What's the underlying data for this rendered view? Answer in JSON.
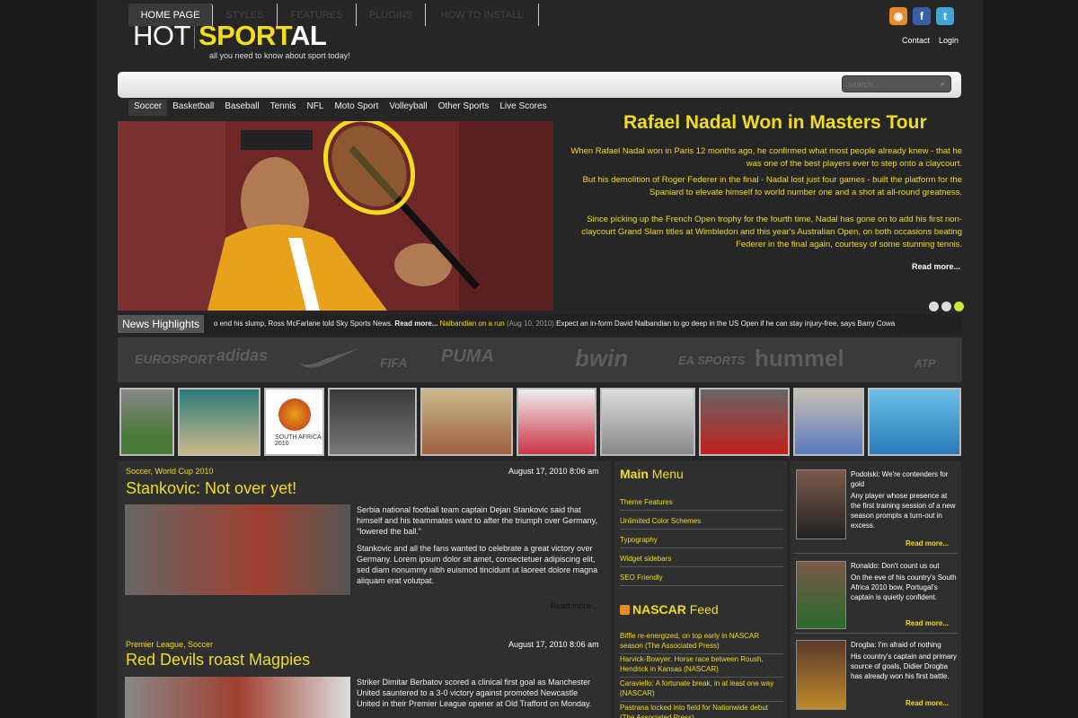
{
  "header": {
    "logo_part1": "HOT",
    "logo_part2": "SPORT",
    "logo_part3": "AL",
    "tagline": "all you need to know about sport today!",
    "links": [
      "Contact",
      "Login"
    ]
  },
  "nav": {
    "tabs": [
      "HOME PAGE",
      "STYLES",
      "FEATURES",
      "PLUGINS",
      "HOW TO INSTALL"
    ],
    "search_placeholder": "search...",
    "subnav": [
      "Soccer",
      "Basketball",
      "Baseball",
      "Tennis",
      "NFL",
      "Moto Sport",
      "Volleyball",
      "Other Sports",
      "Live Scores"
    ]
  },
  "hero": {
    "title": "Rafael Nadal Won in Masters Tour",
    "paragraphs": [
      "When Rafael Nadal won in Paris 12 months ago, he confirmed what most people already knew - that he was one of the best players ever to step onto a claycourt.",
      "But his demolition of Roger Federer in the final - Nadal lost just four games - built the platform for the Spaniard to elevate himself to world number one and a shot at all-round greatness.",
      "Since picking up the French Open trophy for the fourth time, Nadal has gone on to add his first non-claycourt Grand Slam titles at Wimbledon and this year's Australian Open, on both occasions beating Federer in the final again, courtesy of some stunning tennis."
    ],
    "read_more": "Read more..."
  },
  "ticker": {
    "label": "News Highlights",
    "text_pre": "o end his slump, Ross McFarlane told Sky Sports News.",
    "read_more": "Read more...",
    "headline": "Nalbandian on a run",
    "date": "(Aug 10, 2010)",
    "text_post": "Expect an in-form David Nalbandian to go deep in the US Open if he can stay injury-free, says Barry Cowa"
  },
  "sponsors": [
    "EUROSPORT",
    "adidas",
    "nike",
    "FIFA",
    "PUMA",
    "bwin",
    "EA SPORTS",
    "hummel",
    "ATP"
  ],
  "thumbs": [
    "soccer",
    "tennis",
    "world-cup-logo",
    "football",
    "cheerleaders",
    "hockey",
    "motorsport-model",
    "formula-one",
    "basketball",
    "water-polo"
  ],
  "articles": [
    {
      "category": "Soccer, World Cup 2010",
      "date": "August 17, 2010 8:06 am",
      "title": "Stankovic: Not over yet!",
      "paragraphs": [
        "Serbia national football team captain Dejan Stankovic said that himself and his teammates want to after the triumph over Germany, \"lowered the ball.\"",
        "Stankovic and all the fans wanted to celebrate a great victory over Germany. Lorem ipsum dolor sit amet, consectetuer adipiscing elit, sed diam nonummy nibh euismod tincidunt ut laoreet dolore magna aliquam erat volutpat."
      ],
      "read_more": "Read more..."
    },
    {
      "category": "Premier League, Soccer",
      "date": "August 17, 2010 8:06 am",
      "title": "Red Devils roast Magpies",
      "paragraphs": [
        "Striker Dimitar Berbatov scored a clinical first goal as Manchester United sauntered to a 3-0 victory against promoted Newcastle United in their Premier League opener at Old Trafford on Monday."
      ]
    }
  ],
  "main_menu": {
    "title_bold": "Main",
    "title_normal": "Menu",
    "items": [
      "Theme Features",
      "Unlimited Color Schemes",
      "Typography",
      "Widget sidebars",
      "SEO Friendly"
    ]
  },
  "nascar": {
    "title_bold": "NASCAR",
    "title_normal": "Feed",
    "items": [
      "Biffle re-energized, on top early in NASCAR season (The Associated Press)",
      "Harvick-Bowyer: Horse race between Roush, Hendrick in Kansas (NASCAR)",
      "Caraviello: A fortunate break, in at least one way (NASCAR)",
      "Pastrana locked into field for Nationwide debut (The Associated Press)"
    ]
  },
  "news": [
    {
      "text": "Podolski: We're contenders for gold",
      "body": "Any player whose presence at the first training session of a new season prompts a turn-out in excess.",
      "more": "Read more..."
    },
    {
      "text": "Ronaldo: Don't count us out",
      "body": "On the eve of his country's South Africa 2010 bow, Portugal's captain is quietly confident.",
      "more": "Read more..."
    },
    {
      "text": "Drogba: I'm afraid of nothing",
      "body": "His country's captain and primary source of goals, Didier Drogba has already won his first battle.",
      "more": "Read more..."
    }
  ],
  "colors": {
    "accent": "#f2dd1c",
    "bg": "#262626",
    "panel": "#2f2f2f"
  }
}
